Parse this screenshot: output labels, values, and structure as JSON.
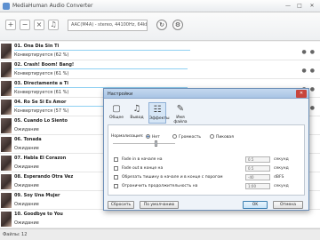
{
  "window": {
    "title": "MediaHuman Audio Converter"
  },
  "toolbar": {
    "format": "AAC(M4A) - stereo, 44100Hz, 64kbps"
  },
  "tracks": [
    {
      "title": "01. Ona Dia Sin Ti",
      "status": "Конвертируется (62 %)",
      "progress": 0.62
    },
    {
      "title": "02. Crash! Boom! Bang!",
      "status": "Конвертируется (61 %)",
      "progress": 0.61
    },
    {
      "title": "03. Directamente a Ti",
      "status": "Конвертируется (61 %)",
      "progress": 0.61
    },
    {
      "title": "04. Ro Se Si Es Amor",
      "status": "Конвертируется (57 %)",
      "progress": 0.57
    },
    {
      "title": "05. Cuando Lo Siento",
      "status": "Ожидание"
    },
    {
      "title": "06. Tonada",
      "status": "Ожидание"
    },
    {
      "title": "07. Habla El Corazon",
      "status": "Ожидание"
    },
    {
      "title": "08. Esperando Otra Vez",
      "status": "Ожидание"
    },
    {
      "title": "09. Soy Una Mujer",
      "status": "Ожидание"
    },
    {
      "title": "10. Goodbye to You",
      "status": "Ожидание"
    }
  ],
  "statusbar": {
    "text": "Файлы: 12"
  },
  "dialog": {
    "title": "Настройки",
    "tabs": [
      "Общее",
      "Вывод",
      "Эффекты",
      "Имя файла"
    ],
    "normalization_label": "Нормализация:",
    "normalization_options": [
      "Нет",
      "Громкость",
      "Пиковая"
    ],
    "options": [
      {
        "label": "Fade in в начале на",
        "value": "0.5",
        "unit": "секунд"
      },
      {
        "label": "Fade out в конце на",
        "value": "0.5",
        "unit": "секунд"
      },
      {
        "label": "Обрезать тишину в начале и в конце с порогом",
        "value": "-40",
        "unit": "dBFS"
      },
      {
        "label": "Ограничить продолжительность на",
        "value": "1:00",
        "unit": "секунд"
      }
    ],
    "buttons": {
      "reset": "Сбросить",
      "defaults": "По умолчанию",
      "ok": "OK",
      "cancel": "Отмена"
    }
  }
}
